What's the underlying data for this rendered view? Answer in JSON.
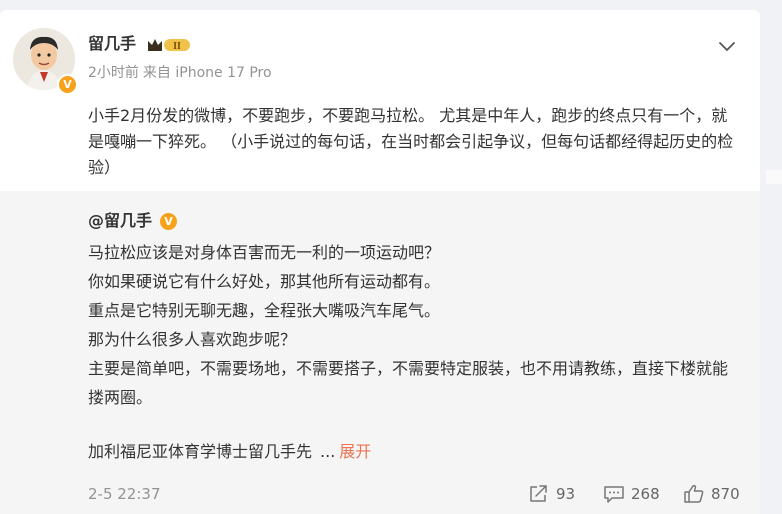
{
  "post": {
    "author": "留几手",
    "meta_time": "2小时前",
    "meta_source": "来自 iPhone 17 Pro",
    "text": "小手2月份发的微博，不要跑步，不要跑马拉松。 尤其是中年人，跑步的终点只有一个，就是嘎嘣一下猝死。 （小手说过的每句话，在当时都会引起争议，但每句话都经得起历史的检验）",
    "verified_badge_glyph": "V",
    "crown_badge_label": "II",
    "icons": [
      "avatar",
      "verified-icon",
      "crown-level-badge",
      "chevron-down-icon"
    ]
  },
  "retweet": {
    "author": "@留几手",
    "verified_badge_glyph": "V",
    "lines": [
      "马拉松应该是对身体百害而无一利的一项运动吧？",
      "你如果硬说它有什么好处，那其他所有运动都有。",
      "重点是它特别无聊无趣，全程张大嘴吸汽车尾气。",
      "那为什么很多人喜欢跑步呢？",
      "主要是简单吧，不需要场地，不需要搭子，不需要特定服装，也不用请教练，直接下楼就能搂两圈。"
    ],
    "summary": "加利福尼亚体育学博士留几手先",
    "ellipsis": "...",
    "expand_label": "展开",
    "time": "2-5 22:37",
    "actions": {
      "share_count": "93",
      "comment_count": "268",
      "like_count": "870"
    },
    "icons": [
      "share-icon",
      "comment-icon",
      "like-icon"
    ]
  },
  "colors": {
    "verified": "#f7a21b",
    "expand_link": "#eb7350",
    "meta_text": "#939393",
    "retweet_bg": "#f5f5f5",
    "page_bg": "#f1f2f5"
  }
}
